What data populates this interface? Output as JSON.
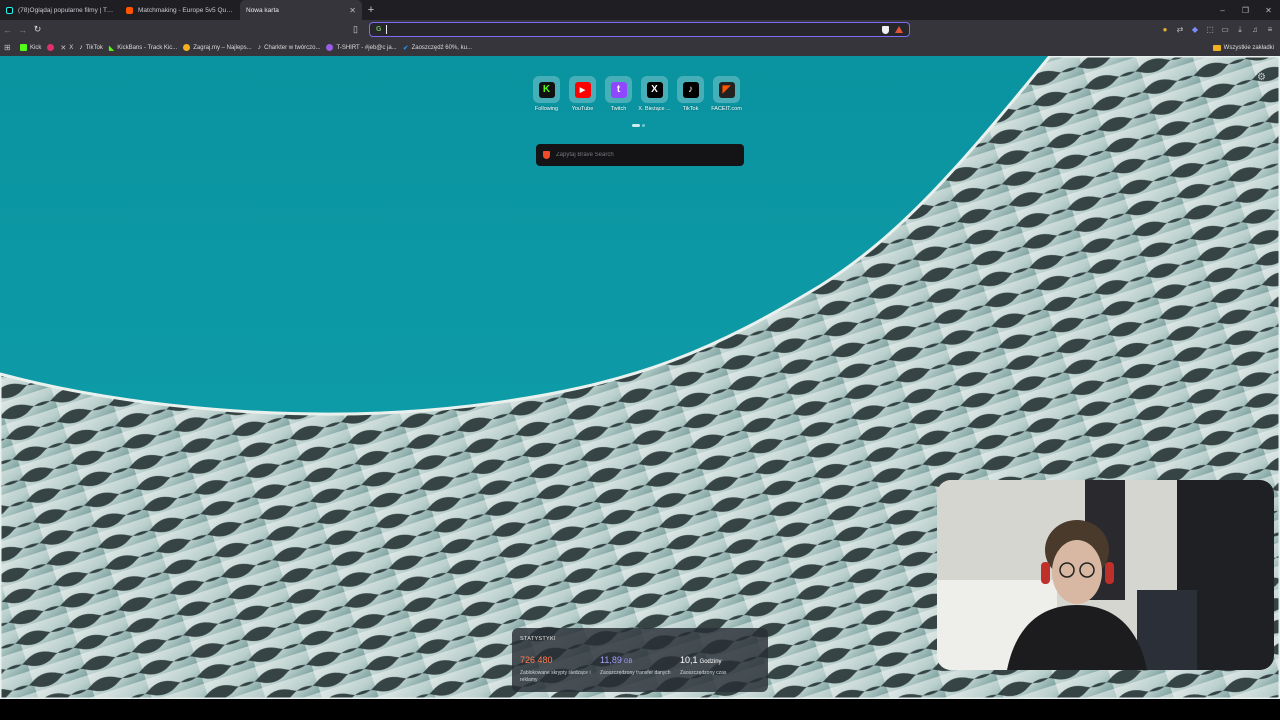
{
  "tabs": [
    {
      "label": "(78)Oglądaj popularne filmy | TikTok",
      "active": false
    },
    {
      "label": "Matchmaking - Europe 5v5 Queue - ...",
      "active": false
    },
    {
      "label": "Nowa karta",
      "active": true
    }
  ],
  "toolbar": {
    "omnibox_value": "",
    "search_engine_icon": "google-icon"
  },
  "bookmarks": [
    {
      "label": "Kick",
      "color": "#53fc18"
    },
    {
      "label": "",
      "color": "#e1306c"
    },
    {
      "label": "X",
      "color": "#000000"
    },
    {
      "label": "TikTok",
      "color": "#111111"
    },
    {
      "label": "KickBans - Track Kic...",
      "color": "#53fc18"
    },
    {
      "label": "Zagraj.my – Najleps...",
      "color": "#f2b01e"
    },
    {
      "label": "Charkter w twórczo...",
      "color": "#111111"
    },
    {
      "label": "T-SHIRT - #jeb@c ja...",
      "color": "#9b5de5"
    },
    {
      "label": "Zaoszczędź 60%, ku...",
      "color": "#1a9fff"
    }
  ],
  "all_bookmarks_label": "Wszystkie zakładki",
  "topsites": [
    {
      "label": "Following",
      "glyph": "K",
      "color": "#53fc18"
    },
    {
      "label": "YouTube",
      "glyph": "▶",
      "color": "#ff0000"
    },
    {
      "label": "Twitch",
      "glyph": "t",
      "color": "#9146ff"
    },
    {
      "label": "X. Bieżące ...",
      "glyph": "X",
      "color": "#000000"
    },
    {
      "label": "TikTok",
      "glyph": "♪",
      "color": "#000000"
    },
    {
      "label": "FACEIT.com",
      "glyph": "◤",
      "color": "#ff5500"
    }
  ],
  "search": {
    "placeholder": "Zapytaj Brave Search"
  },
  "stats": {
    "title": "STATYSTYKI",
    "items": [
      {
        "value": "726 480",
        "unit": "",
        "desc": "Zablokowane skrypty śledzące i reklamy",
        "color": "#ff7a4f"
      },
      {
        "value": "11,89",
        "unit": "GB",
        "desc": "Zaoszczędzony transfer danych",
        "color": "#a79cff"
      },
      {
        "value": "10,1",
        "unit": "Godziny",
        "desc": "Zaoszczędzony czas",
        "color": "#ffffff"
      }
    ]
  },
  "colors": {
    "accent": "#7c6cf5",
    "sky": "#0b97a3"
  }
}
